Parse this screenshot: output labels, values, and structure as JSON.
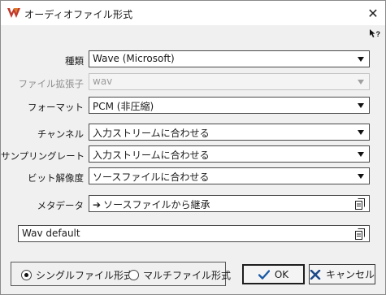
{
  "window": {
    "title": "オーディオファイル形式",
    "close_icon": "✕"
  },
  "rows": [
    {
      "label": "種類",
      "value": "Wave (Microsoft)",
      "enabled": true
    },
    {
      "label": "ファイル拡張子",
      "value": "wav",
      "enabled": false
    },
    {
      "label": "フォーマット",
      "value": "PCM (非圧縮)",
      "enabled": true
    },
    {
      "label": "チャンネル",
      "value": "入力ストリームに合わせる",
      "enabled": true
    },
    {
      "label": "サンプリングレート",
      "value": "入力ストリームに合わせる",
      "enabled": true
    },
    {
      "label": "ビット解像度",
      "value": "ソースファイルに合わせる",
      "enabled": true
    },
    {
      "label": "メタデータ",
      "value": "ソースファイルから継承",
      "arrow": "➔",
      "enabled": true
    }
  ],
  "preset": {
    "value": "Wav default"
  },
  "mode": {
    "options": [
      {
        "label": "シングルファイル形式",
        "checked": true
      },
      {
        "label": "マルチファイル形式",
        "checked": false
      }
    ]
  },
  "buttons": {
    "ok": "OK",
    "cancel": "キャンセル"
  },
  "colors": {
    "accent_blue": "#1a5aa6",
    "cancel_x": "#1e4a8a"
  }
}
